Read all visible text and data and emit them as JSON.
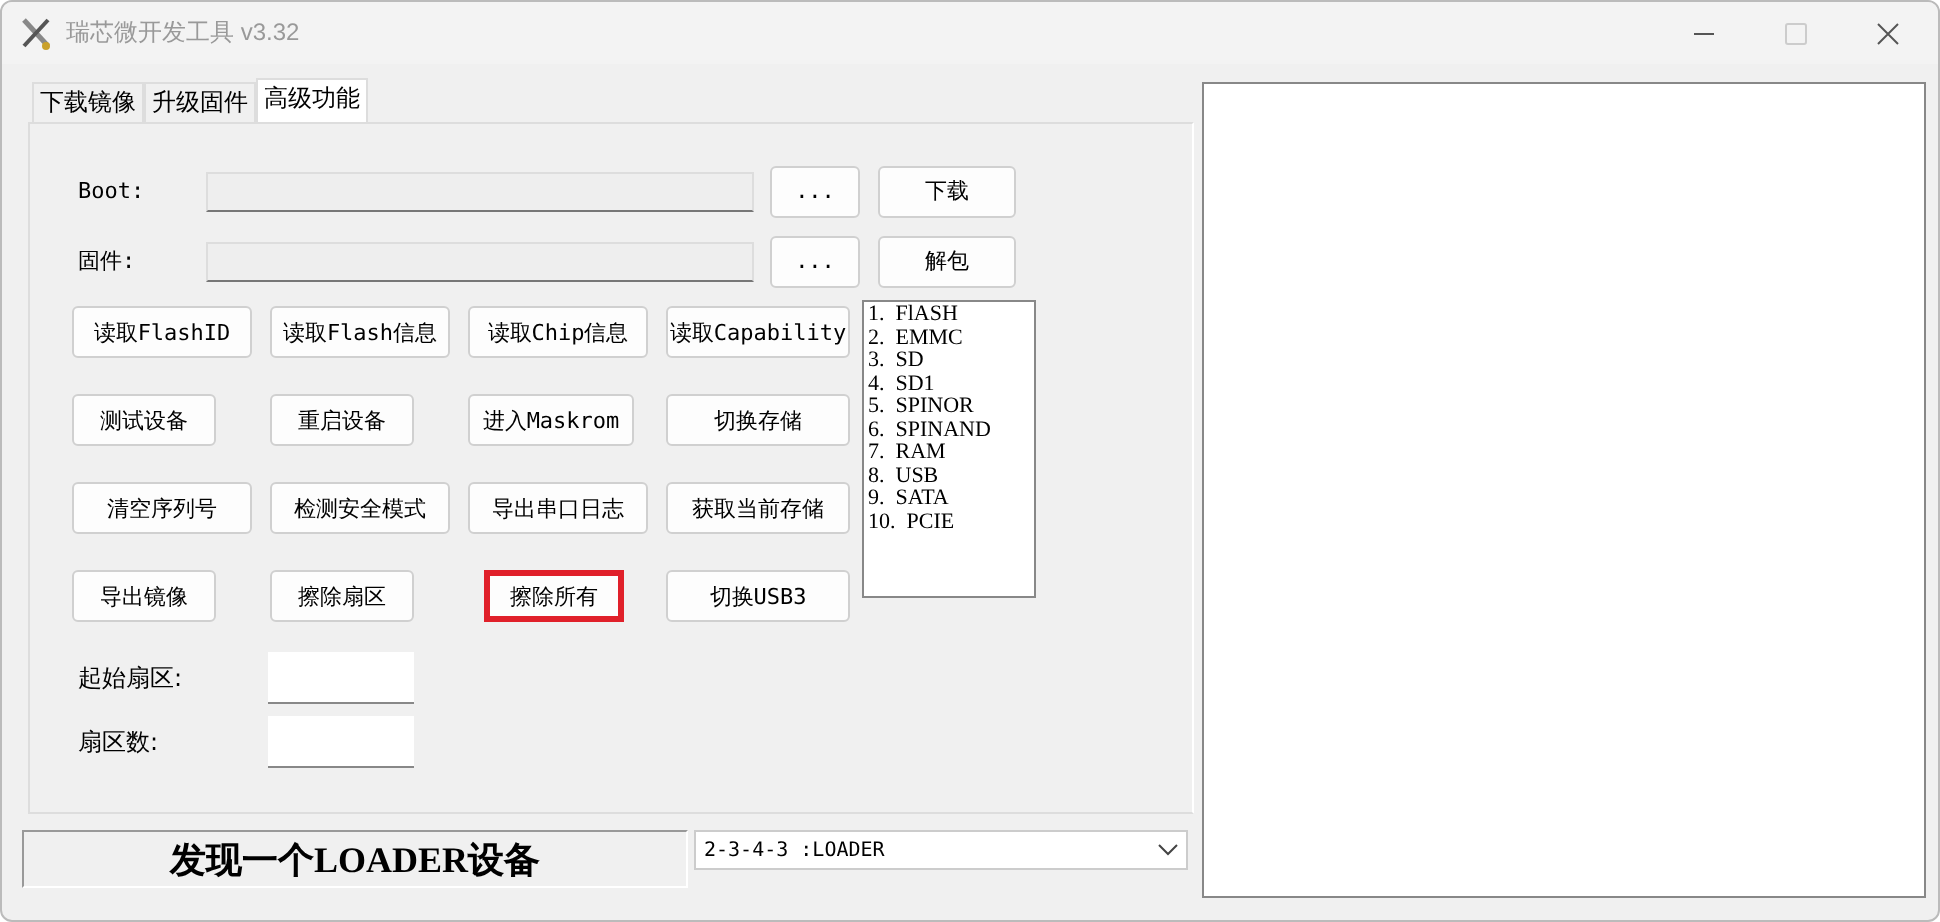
{
  "window": {
    "title": "瑞芯微开发工具 v3.32",
    "maximize_disabled": true
  },
  "tabs": [
    {
      "label": "下载镜像",
      "selected": false
    },
    {
      "label": "升级固件",
      "selected": false
    },
    {
      "label": "高级功能",
      "selected": true
    }
  ],
  "file_rows": [
    {
      "label": "Boot:",
      "browse": "...",
      "action": "下载"
    },
    {
      "label": "固件:",
      "browse": "...",
      "action": "解包"
    }
  ],
  "button_rows": [
    [
      {
        "label": "读取FlashID",
        "highlighted": false
      },
      {
        "label": "读取Flash信息",
        "highlighted": false
      },
      {
        "label": "读取Chip信息",
        "highlighted": false
      },
      {
        "label": "读取Capability",
        "highlighted": false
      }
    ],
    [
      {
        "label": "测试设备",
        "highlighted": false
      },
      {
        "label": "重启设备",
        "highlighted": false
      },
      {
        "label": "进入Maskrom",
        "highlighted": false
      },
      {
        "label": "切换存储",
        "highlighted": false
      }
    ],
    [
      {
        "label": "清空序列号",
        "highlighted": false
      },
      {
        "label": "检测安全模式",
        "highlighted": false
      },
      {
        "label": "导出串口日志",
        "highlighted": false
      },
      {
        "label": "获取当前存储",
        "highlighted": false
      }
    ],
    [
      {
        "label": "导出镜像",
        "highlighted": false
      },
      {
        "label": "擦除扇区",
        "highlighted": false
      },
      {
        "label": "擦除所有",
        "highlighted": true
      },
      {
        "label": "切换USB3",
        "highlighted": false
      }
    ]
  ],
  "storage_list": [
    "1.  FlASH",
    "2.  EMMC",
    "3.  SD",
    "4.  SD1",
    "5.  SPINOR",
    "6.  SPINAND",
    "7.  RAM",
    "8.  USB",
    "9.  SATA",
    "10.  PCIE"
  ],
  "sector_fields": [
    {
      "label": "起始扇区:"
    },
    {
      "label": "扇区数:"
    }
  ],
  "status": "发现一个LOADER设备",
  "device_select": {
    "value": "2-3-4-3 :LOADER"
  }
}
